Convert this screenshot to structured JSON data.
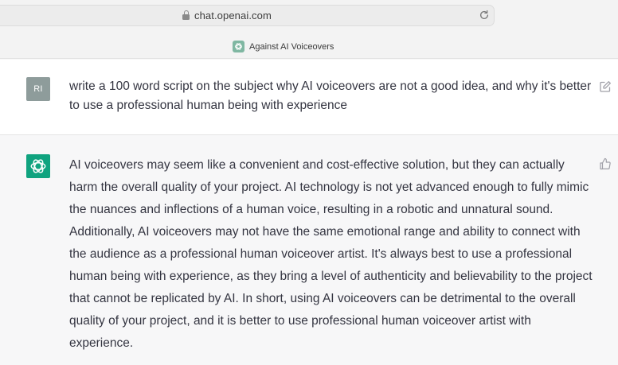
{
  "browser": {
    "url": "chat.openai.com",
    "tab_title": "Against AI Voiceovers",
    "icons": [
      "lock-icon",
      "reload-icon",
      "openai-favicon"
    ]
  },
  "conversation": {
    "user_message": {
      "avatar_initials": "RI",
      "text": "write a 100 word script on the subject why AI voiceovers are not a good idea, and why it's better to use a professional human being with experience",
      "action_icon": "edit-icon"
    },
    "assistant_message": {
      "text": "AI voiceovers may seem like a convenient and cost-effective solution, but they can actually harm the overall quality of your project. AI technology is not yet advanced enough to fully mimic the nuances and inflections of a human voice, resulting in a robotic and unnatural sound. Additionally, AI voiceovers may not have the same emotional range and ability to connect with the audience as a professional human voiceover artist. It's always best to use a professional human being with experience, as they bring a level of authenticity and believability to the project that cannot be replicated by AI. In short, using AI voiceovers can be detrimental to the overall quality of your project, and it is better to use professional human voiceover artist with experience.",
      "action_icon": "thumbs-up-icon"
    }
  },
  "colors": {
    "assistant_avatar": "#10a37f",
    "user_avatar": "#8e9c9b",
    "user_row_bg": "#ffffff",
    "assistant_row_bg": "#f7f7f8"
  }
}
